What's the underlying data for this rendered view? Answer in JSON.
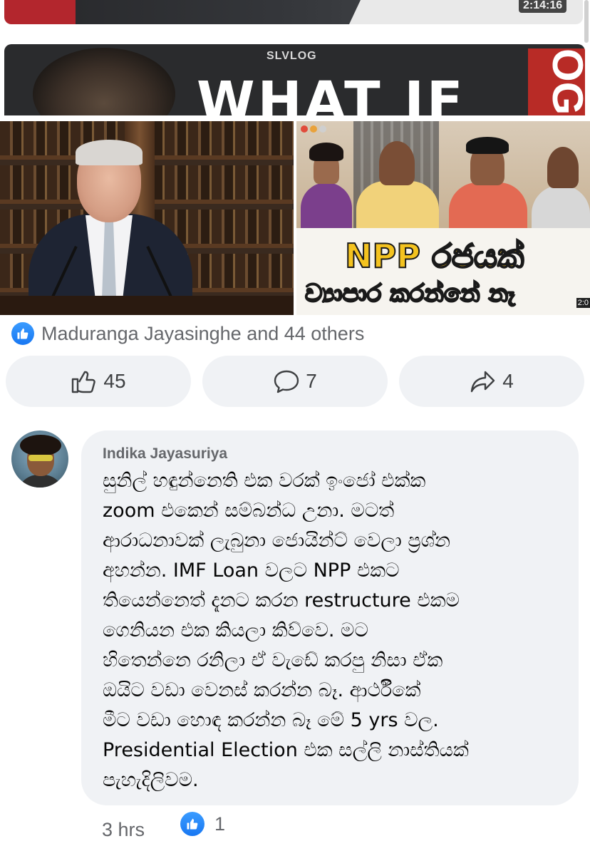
{
  "video": {
    "timestamp": "2:14:16"
  },
  "banner": {
    "channel_logo": "SLVLOG",
    "headline": "WHAT IF",
    "side_text": "OG"
  },
  "thumbnail_right": {
    "headline_line1": "NPP රජයක්",
    "headline_line2": "ව්‍යාපාර කරන්නේ නෑ",
    "duration": "2:0"
  },
  "reactions": {
    "icon": "like-icon",
    "summary": "Maduranga Jayasinghe and 44 others"
  },
  "actions": {
    "like_count": "45",
    "comment_count": "7",
    "share_count": "4"
  },
  "comment": {
    "author": "Indika Jayasuriya",
    "text": "සුනිල් හඳුන්නෙති එක වරක් ඉංජෝ එක්ක\nzoom එකෙන් සම්බන්ධ උනා. මටත්\nආරාධනාවක් ලැබුනා ජොයින්ට් වෙලා ප්‍රශ්න\nඅහන්න. IMF Loan වලට NPP එකට\nතියෙන්නෙත් දැනට කරන restructure එකම\nගෙනියන එක කියලා කිව්වෙ. මට\nහිතෙන්නෙ රනිලා ඒ වැඩේ  කරපු නිසා ඒක\nඔයිට වඩා වෙනස් කරන්න බෑ. ආර්ථීකේ\nමීට වඩා හොඳ කරන්න බෑ මේ 5 yrs වල.\nPresidential Election එක සල්ලි නාස්තියක්\nපැහැදිලිවම.",
    "time": "3 hrs",
    "like_count": "1"
  },
  "colors": {
    "accent": "#1877f2",
    "bubble": "#f0f2f5",
    "meta_text": "#65676b"
  }
}
